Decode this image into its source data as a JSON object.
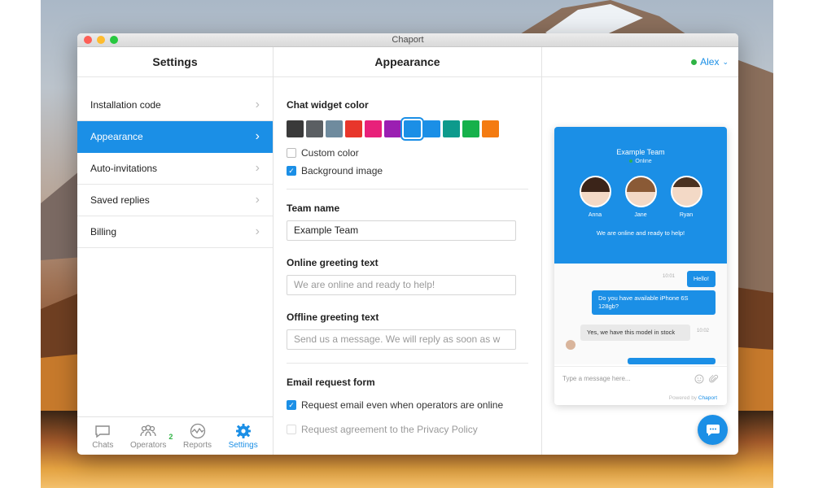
{
  "window": {
    "title": "Chaport"
  },
  "left": {
    "header": "Settings",
    "menu": [
      {
        "label": "Installation code"
      },
      {
        "label": "Appearance"
      },
      {
        "label": "Auto-invitations"
      },
      {
        "label": "Saved replies"
      },
      {
        "label": "Billing"
      }
    ],
    "nav": [
      {
        "label": "Chats",
        "icon": "chat-bubble-icon"
      },
      {
        "label": "Operators",
        "icon": "operators-icon",
        "badge": "2"
      },
      {
        "label": "Reports",
        "icon": "reports-icon"
      },
      {
        "label": "Settings",
        "icon": "gear-icon"
      }
    ]
  },
  "middle": {
    "header": "Appearance",
    "widget_color": {
      "title": "Chat widget color",
      "swatches": [
        "#3a3a3a",
        "#5b5f63",
        "#6f8b9e",
        "#e8362b",
        "#e8217a",
        "#9b1fb2",
        "#1b8fe6",
        "#1b8fe6",
        "#0d9a8c",
        "#16b14b",
        "#f47b11"
      ],
      "selected_index": 6,
      "custom_color_label": "Custom color",
      "background_image_label": "Background image"
    },
    "team_name": {
      "title": "Team name",
      "value": "Example Team"
    },
    "online_greeting": {
      "title": "Online greeting text",
      "placeholder": "We are online and ready to help!"
    },
    "offline_greeting": {
      "title": "Offline greeting text",
      "placeholder": "Send us a message. We will reply as soon as w"
    },
    "email_form": {
      "title": "Email request form",
      "request_email_label": "Request email even when operators are online",
      "privacy_label": "Request agreement to the Privacy Policy"
    }
  },
  "right": {
    "user": "Alex",
    "preview": {
      "team": "Example Team",
      "status": "Online",
      "agents": [
        {
          "name": "Anna"
        },
        {
          "name": "Jane"
        },
        {
          "name": "Ryan"
        }
      ],
      "greeting": "We are online and ready to help!",
      "messages": {
        "m1": "Hello!",
        "m2": "Do you have available iPhone 6S 128gb?",
        "m3": "Yes, we have this model in stock",
        "t1": "10:01",
        "t3": "10:02"
      },
      "input_placeholder": "Type a message here...",
      "powered_prefix": "Powered by",
      "powered_brand": "Chaport"
    }
  }
}
